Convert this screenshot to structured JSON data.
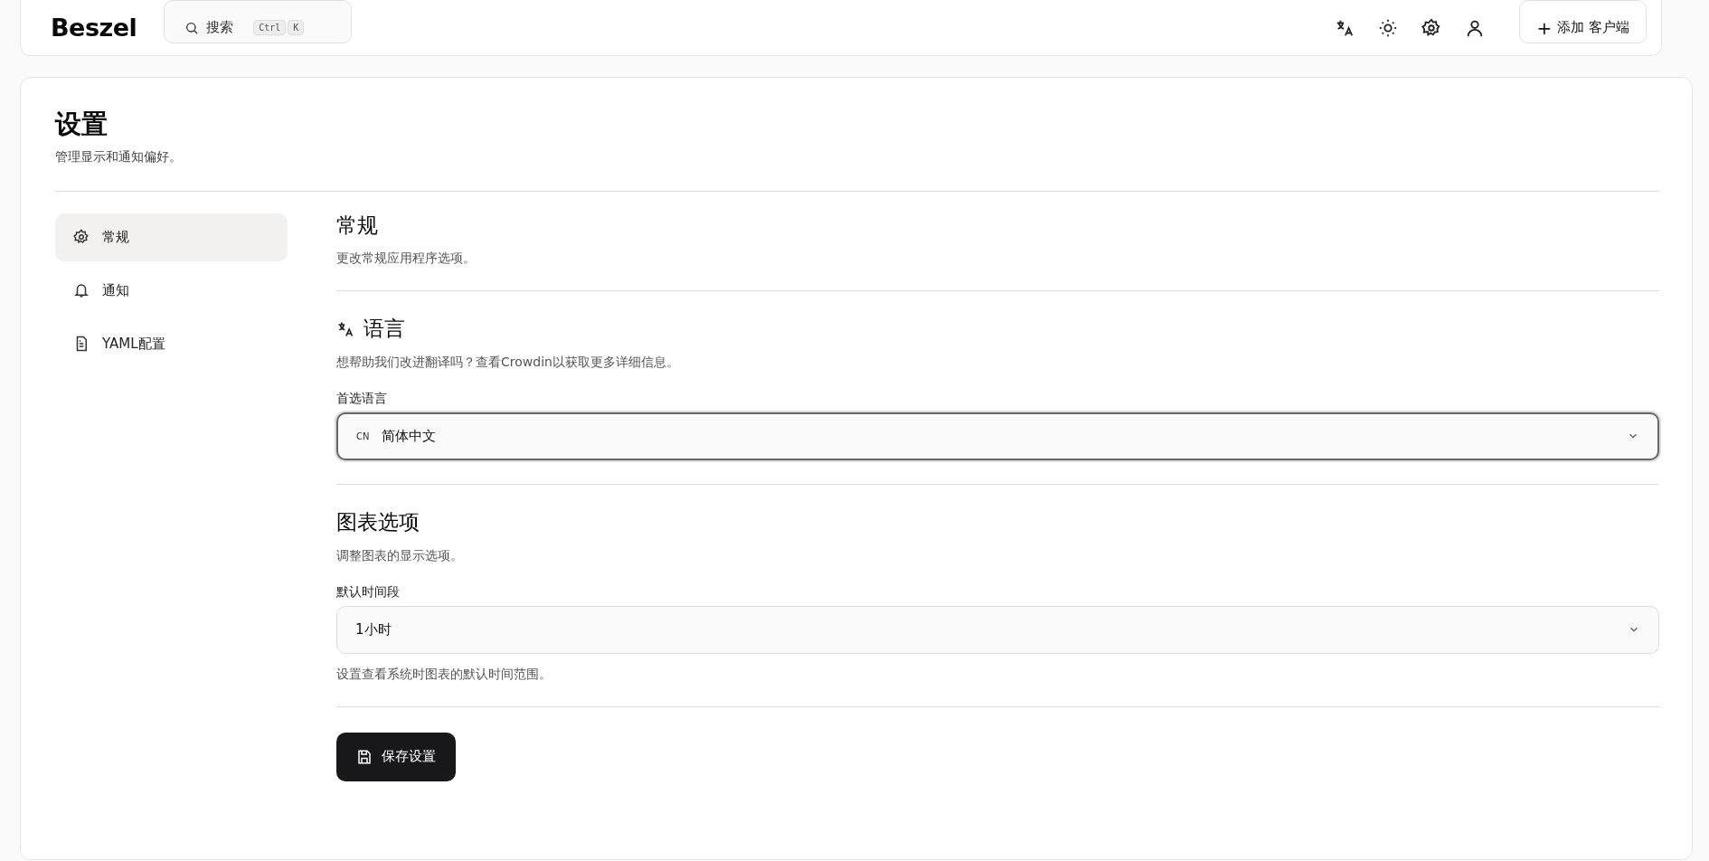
{
  "header": {
    "logo": "Beszel",
    "search": {
      "label": "搜索",
      "keys": [
        "Ctrl",
        "K"
      ]
    },
    "add_button": {
      "icon": "+",
      "label": "添加 客户端"
    }
  },
  "page": {
    "title": "设置",
    "subtitle": "管理显示和通知偏好。"
  },
  "sidebar": {
    "items": [
      {
        "label": "常规",
        "kind": "gear",
        "selected": true
      },
      {
        "label": "通知",
        "kind": "bell",
        "selected": false
      },
      {
        "label": "YAML配置",
        "kind": "file",
        "selected": false
      }
    ]
  },
  "general": {
    "title": "常规",
    "description": "更改常规应用程序选项。"
  },
  "language": {
    "title": "语言",
    "help_before": "想帮助我们改进翻译吗？查看",
    "help_link": "Crowdin",
    "help_after": "以获取更多详细信息。",
    "label": "首选语言",
    "select": {
      "flag": "CN",
      "value": "简体中文",
      "focused": true
    }
  },
  "chart_options": {
    "title": "图表选项",
    "description": "调整图表的显示选项。",
    "label": "默认时间段",
    "select": {
      "value": "1小时",
      "focused": false
    },
    "help": "设置查看系统时图表的默认时间范围。"
  },
  "save_button": {
    "label": "保存设置"
  }
}
